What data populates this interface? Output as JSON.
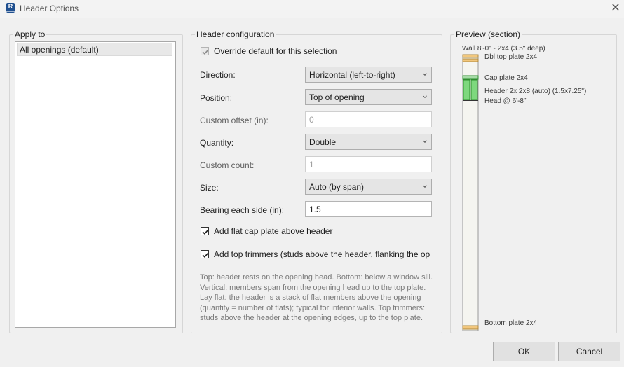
{
  "window": {
    "title": "Header Options",
    "app_icon_letter": "R"
  },
  "apply_to": {
    "legend": "Apply to",
    "items": [
      "All openings (default)"
    ]
  },
  "config": {
    "legend": "Header configuration",
    "override": {
      "label": "Override default for this selection",
      "checked": true,
      "enabled": false
    },
    "direction": {
      "label": "Direction:",
      "value": "Horizontal (left-to-right)"
    },
    "position": {
      "label": "Position:",
      "value": "Top of opening"
    },
    "custom_offset": {
      "label": "Custom offset (in):",
      "value": "0"
    },
    "quantity": {
      "label": "Quantity:",
      "value": "Double"
    },
    "custom_count": {
      "label": "Custom count:",
      "value": "1"
    },
    "size": {
      "label": "Size:",
      "value": "Auto (by span)"
    },
    "bearing": {
      "label": "Bearing each side (in):",
      "value": "1.5"
    },
    "cap_plate": {
      "label": "Add flat cap plate above header",
      "checked": true
    },
    "top_trimmers": {
      "label": "Add top trimmers (studs above the header, flanking the op",
      "checked": true
    },
    "help_lines": [
      "Top: header rests on the opening head. Bottom: below a window sill.",
      "Vertical: members span from the opening head up to the top plate.",
      "Lay flat: the header is a stack of flat members above the opening",
      "(quantity = number of flats); typical for interior walls. Top trimmers:",
      "studs above the header at the opening edges, up to the top plate."
    ]
  },
  "preview": {
    "legend": "Preview (section)",
    "wall_label": "Wall 8'-0\" - 2x4 (3.5\" deep)",
    "top_plate_label": "Dbl top plate 2x4",
    "cap_plate_label": "Cap plate 2x4",
    "header_label": "Header 2x 2x8 (auto) (1.5x7.25\")",
    "head_label": "Head @ 6'-8\"",
    "bottom_plate_label": "Bottom plate 2x4",
    "colors": {
      "plate_fill": "#f2c77c",
      "plate_stroke": "#b08a3e",
      "header_fill": "#7ed87e",
      "header_stroke": "#2f8f2f",
      "cap_fill": "#a6dba6",
      "wall_fill": "#f5f5f0",
      "wall_stroke": "#9a9a9a"
    }
  },
  "buttons": {
    "ok": "OK",
    "cancel": "Cancel"
  }
}
